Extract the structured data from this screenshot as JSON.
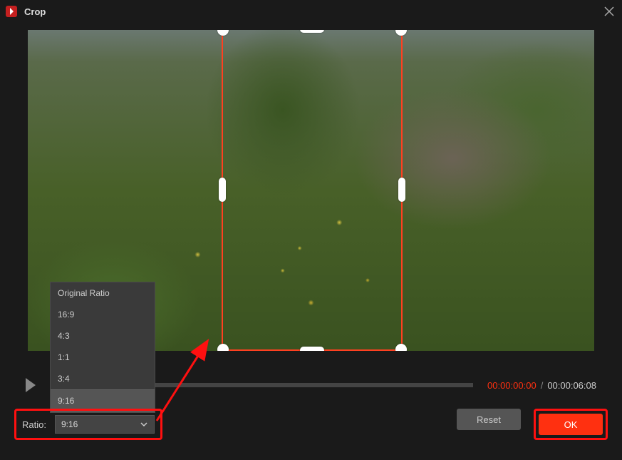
{
  "titlebar": {
    "title": "Crop"
  },
  "playback": {
    "current_time": "00:00:00:00",
    "total_time": "00:00:06:08",
    "separator": "/"
  },
  "ratio_control": {
    "label": "Ratio:",
    "selected": "9:16",
    "options": [
      "Original Ratio",
      "16:9",
      "4:3",
      "1:1",
      "3:4",
      "9:16"
    ]
  },
  "buttons": {
    "reset": "Reset",
    "ok": "OK"
  }
}
